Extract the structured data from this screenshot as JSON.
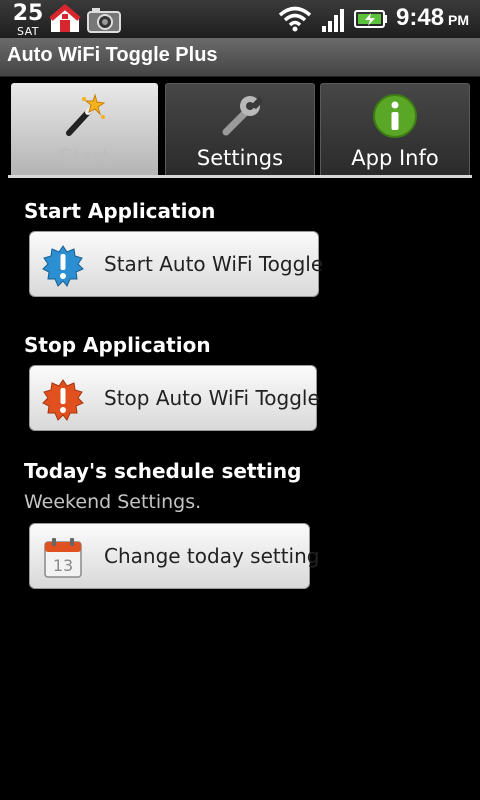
{
  "status_bar": {
    "date_day": "25",
    "date_dow": "SAT",
    "time": "9:48",
    "ampm": "PM",
    "icons": [
      "home-icon",
      "camera-icon",
      "wifi-icon",
      "signal-icon",
      "battery-charging-icon"
    ]
  },
  "app": {
    "title": "Auto WiFi Toggle Plus"
  },
  "tabs": [
    {
      "label": "Start",
      "icon": "magic-wand-icon",
      "active": true
    },
    {
      "label": "Settings",
      "icon": "wrench-icon",
      "active": false
    },
    {
      "label": "App Info",
      "icon": "info-icon",
      "active": false
    }
  ],
  "start_section": {
    "title": "Start Application",
    "button_label": "Start Auto WiFi Toggle",
    "icon": "blue-alert-icon"
  },
  "stop_section": {
    "title": "Stop Application",
    "button_label": "Stop Auto WiFi Toggle",
    "icon": "red-alert-icon"
  },
  "schedule_section": {
    "title": "Today's schedule setting",
    "subtitle": "Weekend Settings.",
    "button_label": "Change today setting",
    "calendar_day": "13",
    "icon": "calendar-icon"
  },
  "colors": {
    "background": "#000000",
    "button_face": "#f0f0f0",
    "start_icon": "#2b8fd1",
    "stop_icon": "#e0511f"
  }
}
